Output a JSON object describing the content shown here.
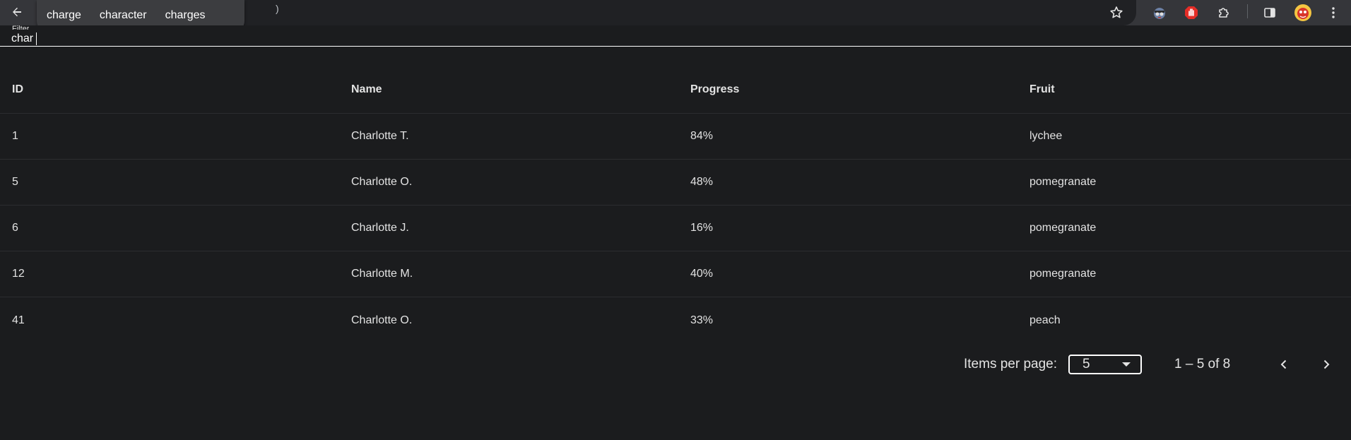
{
  "browser": {
    "omnibox_partial": ")",
    "suggestions": [
      "charge",
      "character",
      "charges"
    ]
  },
  "filter": {
    "label": "Filter",
    "value": "char"
  },
  "table": {
    "columns": [
      "ID",
      "Name",
      "Progress",
      "Fruit"
    ],
    "rows": [
      [
        "1",
        "Charlotte T.",
        "84%",
        "lychee"
      ],
      [
        "5",
        "Charlotte O.",
        "48%",
        "pomegranate"
      ],
      [
        "6",
        "Charlotte J.",
        "16%",
        "pomegranate"
      ],
      [
        "12",
        "Charlotte M.",
        "40%",
        "pomegranate"
      ],
      [
        "41",
        "Charlotte O.",
        "33%",
        "peach"
      ]
    ]
  },
  "paginator": {
    "items_per_page_label": "Items per page:",
    "items_per_page_value": "5",
    "range_label": "1 – 5 of 8"
  },
  "colors": {
    "background": "#1b1c1e",
    "toolbar": "#35363a",
    "text": "#e3e3e3"
  }
}
